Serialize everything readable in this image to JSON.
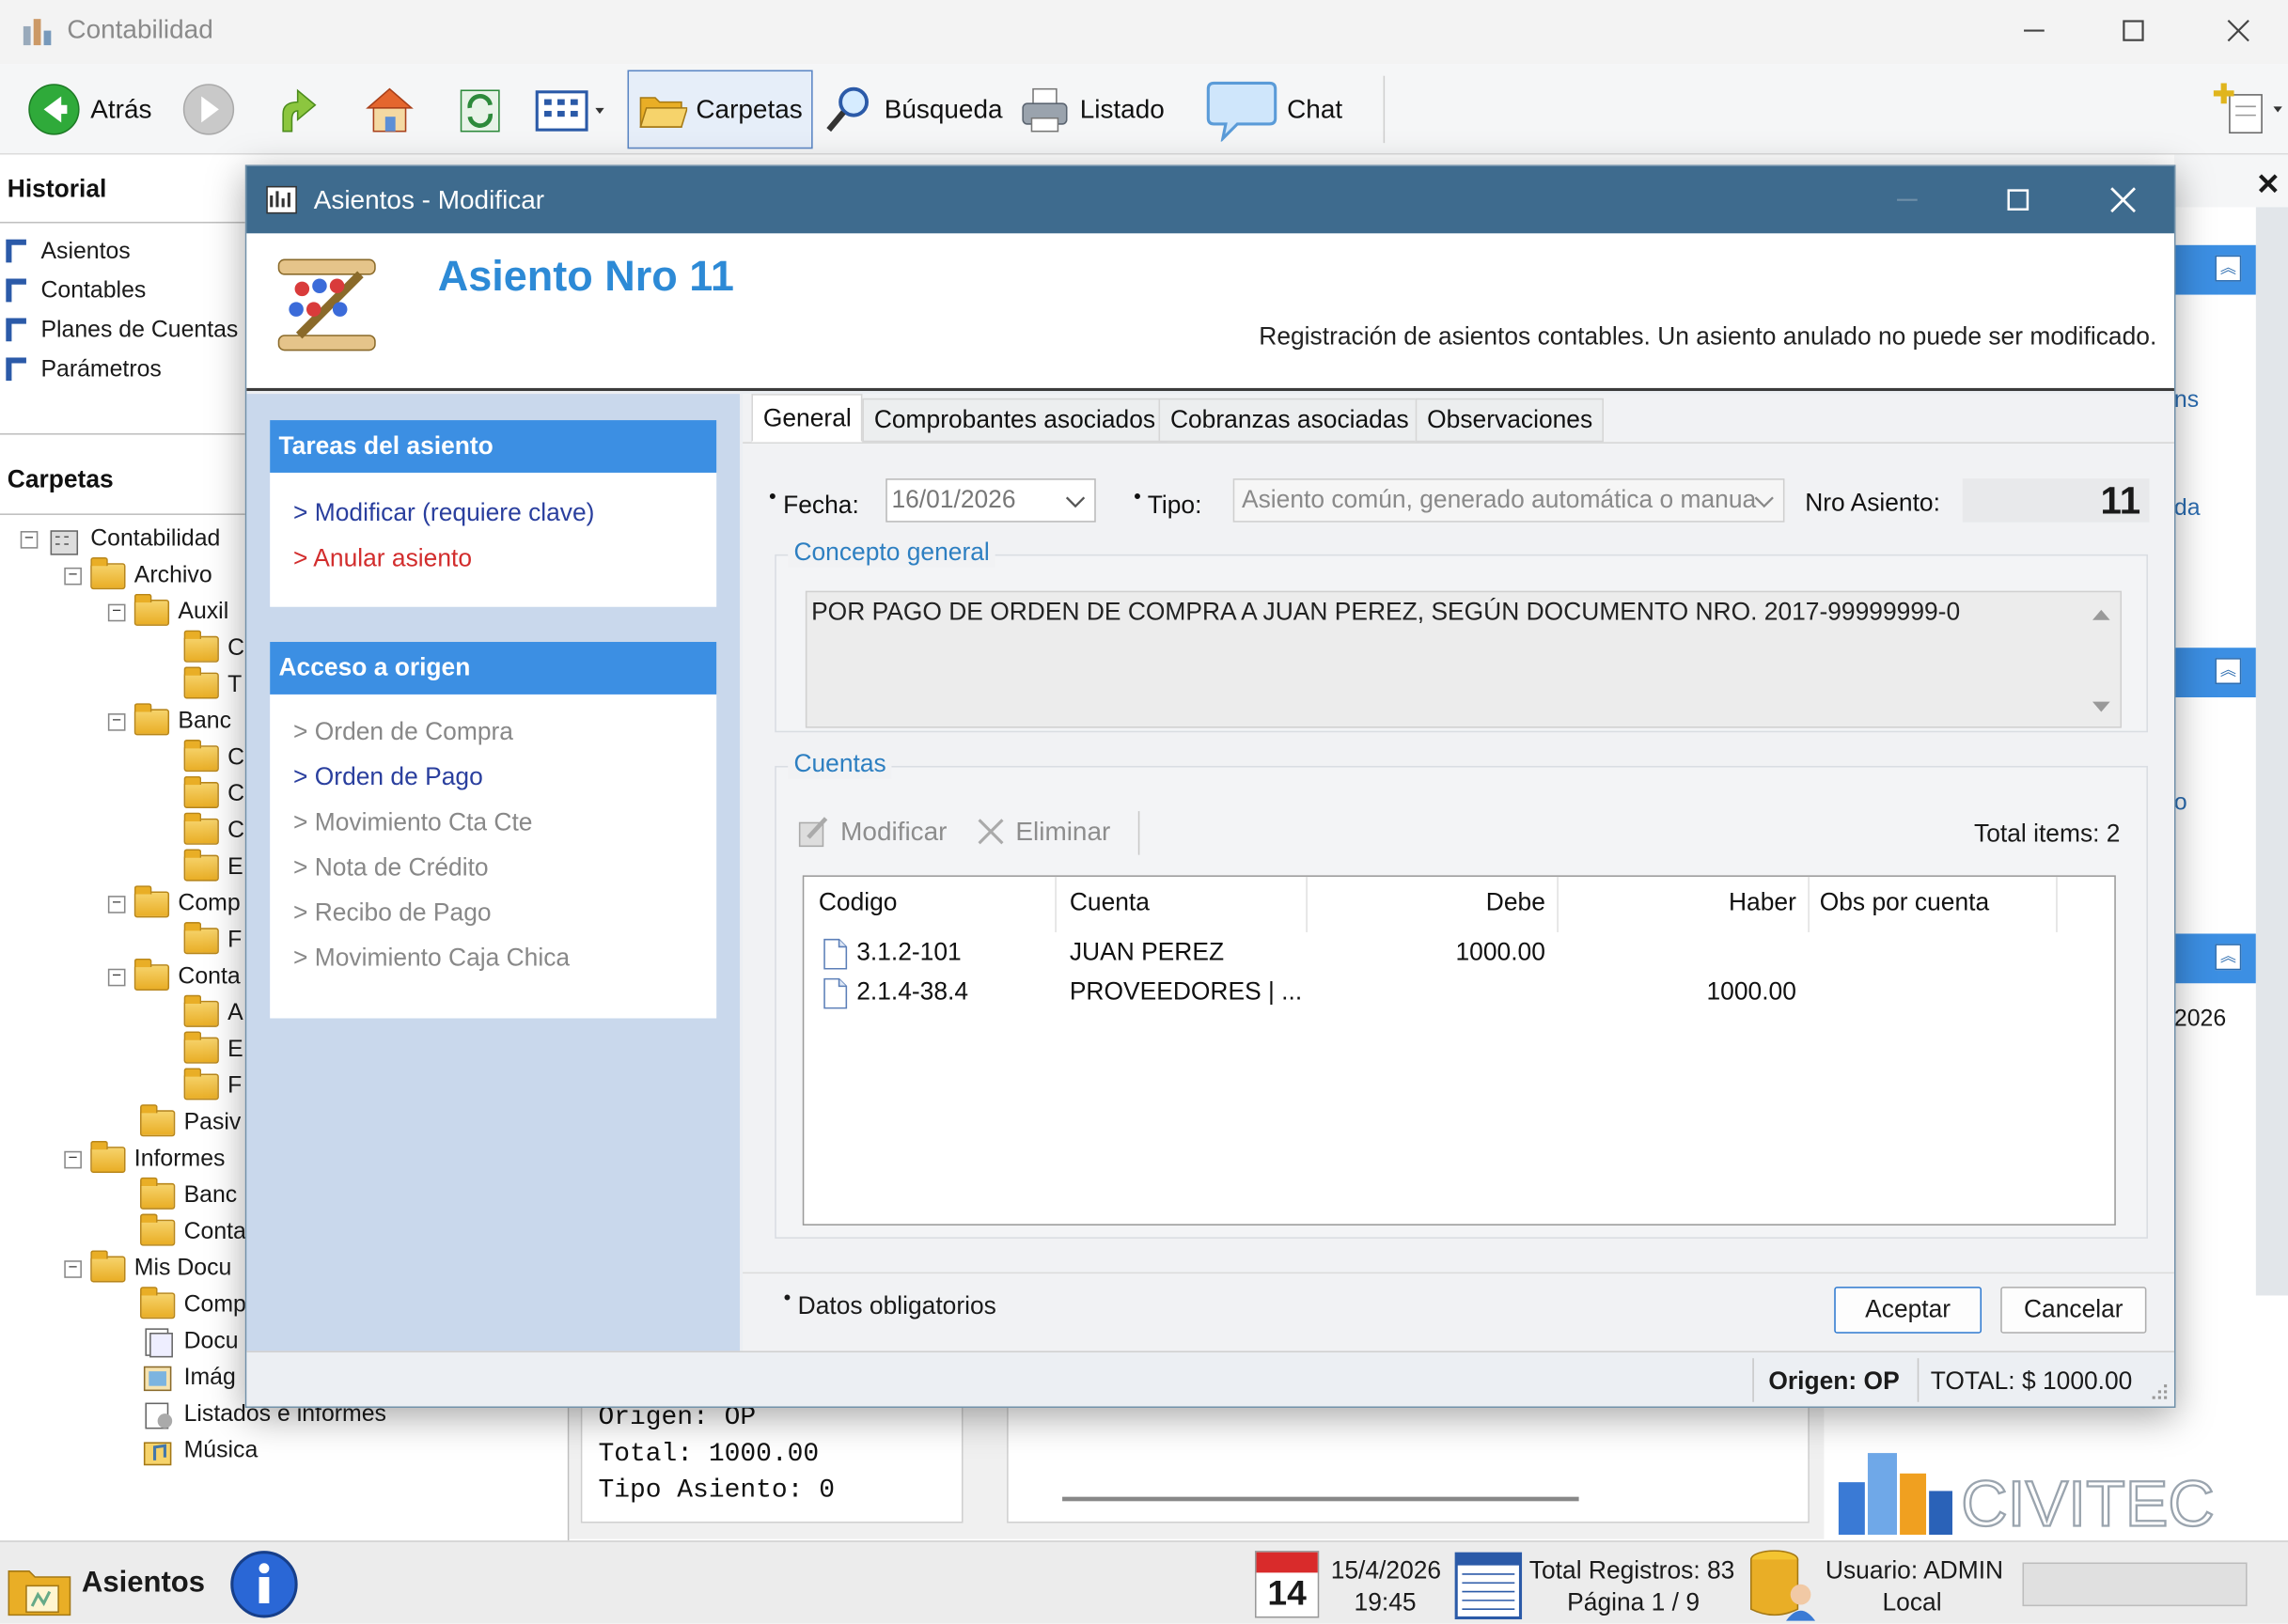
{
  "app": {
    "title": "Contabilidad"
  },
  "toolbar": {
    "back": "Atrás",
    "carpetas": "Carpetas",
    "busqueda": "Búsqueda",
    "listado": "Listado",
    "chat": "Chat"
  },
  "historial": {
    "title": "Historial",
    "items": [
      "Asientos",
      "Contables",
      "Planes de Cuentas",
      "Parámetros"
    ]
  },
  "carpetas": {
    "title": "Carpetas",
    "tree": [
      "Contabilidad",
      "Archivo",
      "Auxil",
      "C",
      "T",
      "Banc",
      "C",
      "C",
      "C",
      "E",
      "Comp",
      "F",
      "Conta",
      "A",
      "E",
      "F",
      "Pasiv",
      "Informes",
      "Banc",
      "Conta",
      "Mis Docu",
      "Comp",
      "Docu",
      "Imág",
      "Listados e informes",
      "Música"
    ]
  },
  "right_partial": {
    "text1": "ns",
    "text2": "da",
    "text3": "o",
    "text4": "2026"
  },
  "behind": {
    "line1": "Origen: OP",
    "line2": "Total: 1000.00",
    "line3": "Tipo Asiento: 0"
  },
  "dialog": {
    "title": "Asientos - Modificar",
    "heading": "Asiento Nro 11",
    "description": "Registración de asientos contables. Un asiento anulado no puede ser modificado.",
    "tareas": {
      "title": "Tareas del asiento",
      "modificar": "> Modificar (requiere clave)",
      "anular": "> Anular asiento"
    },
    "acceso": {
      "title": "Acceso a origen",
      "items": [
        "> Orden de Compra",
        "> Orden de Pago",
        "> Movimiento Cta Cte",
        "> Nota de Crédito",
        "> Recibo de Pago",
        "> Movimiento Caja Chica"
      ]
    },
    "tabs": [
      "General",
      "Comprobantes asociados",
      "Cobranzas asociadas",
      "Observaciones"
    ],
    "fecha_label": "Fecha:",
    "fecha_value": "16/01/2026",
    "tipo_label": "Tipo:",
    "tipo_value": "Asiento común, generado automática o manua",
    "nro_label": "Nro Asiento:",
    "nro_value": "11",
    "concepto_title": "Concepto general",
    "concepto_text": "POR PAGO DE ORDEN DE COMPRA A JUAN PEREZ, SEGÚN DOCUMENTO NRO. 2017-99999999-0",
    "cuentas_title": "Cuentas",
    "modificar_btn": "Modificar",
    "eliminar_btn": "Eliminar",
    "total_items": "Total items: 2",
    "columns": [
      "Codigo",
      "Cuenta",
      "Debe",
      "Haber",
      "Obs por cuenta"
    ],
    "rows": [
      {
        "codigo": "3.1.2-101",
        "cuenta": "JUAN PEREZ",
        "debe": "1000.00",
        "haber": ""
      },
      {
        "codigo": "2.1.4-38.4",
        "cuenta": "PROVEEDORES | ...",
        "debe": "",
        "haber": "1000.00"
      }
    ],
    "datos_obligatorios": "Datos obligatorios",
    "aceptar": "Aceptar",
    "cancelar": "Cancelar",
    "origen": "Origen: OP",
    "total": "TOTAL: $ 1000.00"
  },
  "statusbar": {
    "module": "Asientos",
    "cal_day": "14",
    "date": "15/4/2026",
    "time": "19:45",
    "total_registros": "Total Registros: 83",
    "pagina": "Página 1 / 9",
    "usuario": "Usuario: ADMIN",
    "local": "Local",
    "brand": "CIVITEC"
  }
}
